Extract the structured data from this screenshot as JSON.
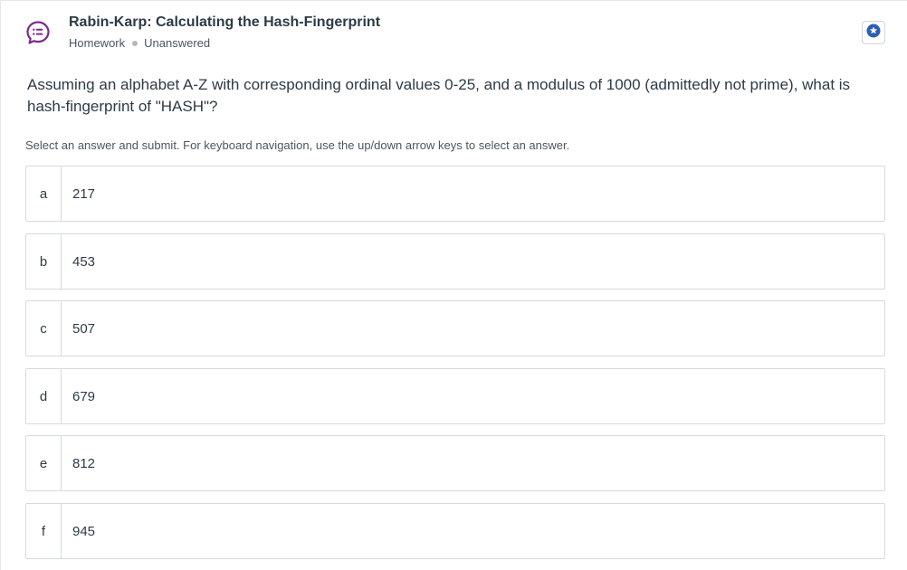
{
  "header": {
    "title": "Rabin-Karp: Calculating the Hash-Fingerprint",
    "type": "Homework",
    "status": "Unanswered",
    "icon": "discussion-bubble-icon",
    "bookmark_icon": "star-badge-icon",
    "accent_color": "#7b2a8c"
  },
  "question": {
    "text": "Assuming an alphabet A-Z with corresponding ordinal values 0-25, and a modulus of 1000 (admittedly not prime), what is hash-fingerprint of \"HASH\"?"
  },
  "instructions": "Select an answer and submit. For keyboard navigation, use the up/down arrow keys to select an answer.",
  "answers": [
    {
      "letter": "a",
      "value": "217"
    },
    {
      "letter": "b",
      "value": "453"
    },
    {
      "letter": "c",
      "value": "507"
    },
    {
      "letter": "d",
      "value": "679"
    },
    {
      "letter": "e",
      "value": "812"
    },
    {
      "letter": "f",
      "value": "945"
    }
  ]
}
